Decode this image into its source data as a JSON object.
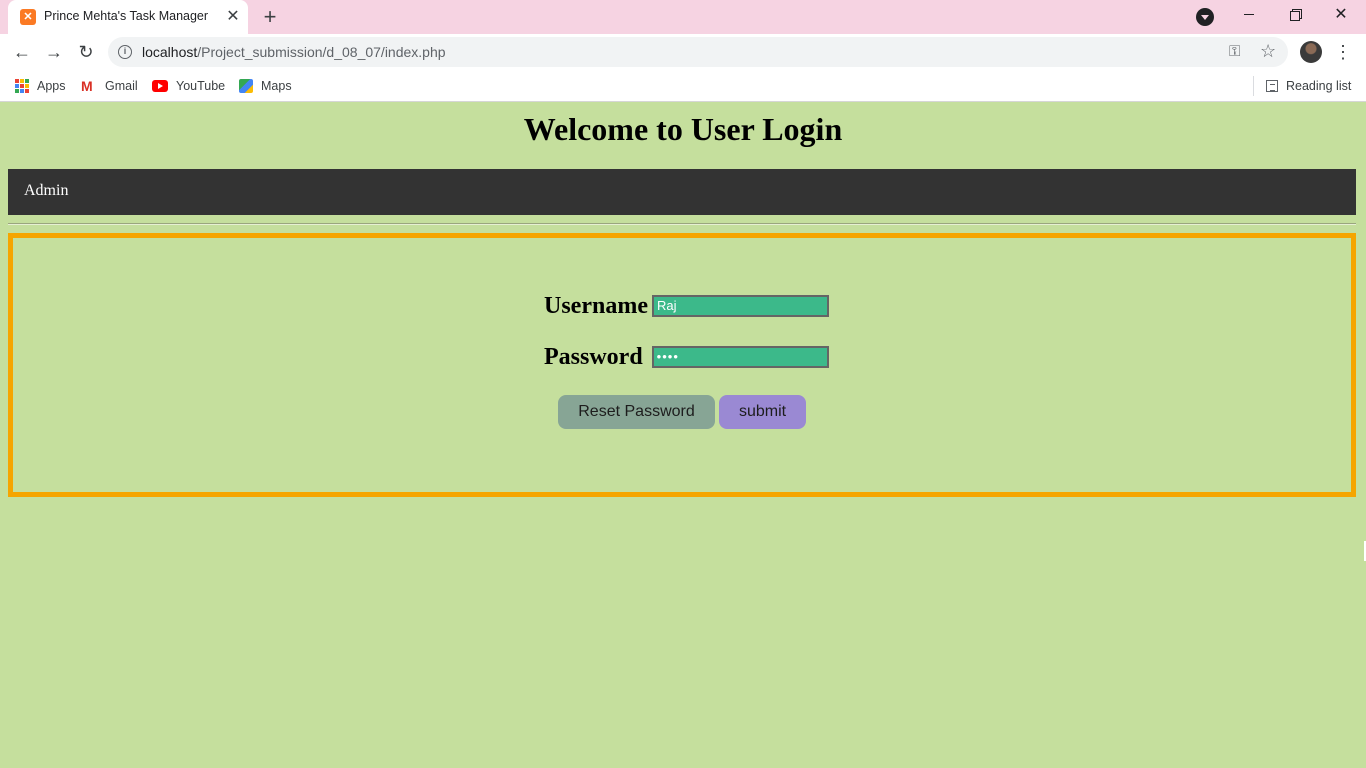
{
  "browser": {
    "tab_title": "Prince Mehta's Task Manager",
    "tab_favicon": "xampp-icon",
    "tab_close": "✕",
    "new_tab": "+",
    "url_host": "localhost",
    "url_path": "/Project_submission/d_08_07/index.php",
    "window_close": "✕",
    "menu": "⋮",
    "bookmarks": [
      {
        "label": "Apps",
        "icon": "apps-grid-icon"
      },
      {
        "label": "Gmail",
        "icon": "gmail-icon"
      },
      {
        "label": "YouTube",
        "icon": "youtube-icon"
      },
      {
        "label": "Maps",
        "icon": "maps-icon"
      }
    ],
    "reading_list": "Reading list"
  },
  "page": {
    "title": "Welcome to User Login",
    "nav_link": "Admin",
    "form": {
      "username_label": "Username",
      "username_value": "Raj",
      "password_label": "Password",
      "password_value": "••••",
      "reset_button": "Reset Password",
      "submit_button": "submit"
    }
  },
  "colors": {
    "page_bg": "#c5df9d",
    "navbar_bg": "#333333",
    "box_border": "#f5a500",
    "input_bg": "#3cb98a",
    "reset_bg": "#87a595",
    "submit_bg": "#9a89d3",
    "tabstrip_bg": "#f6d3e2"
  }
}
